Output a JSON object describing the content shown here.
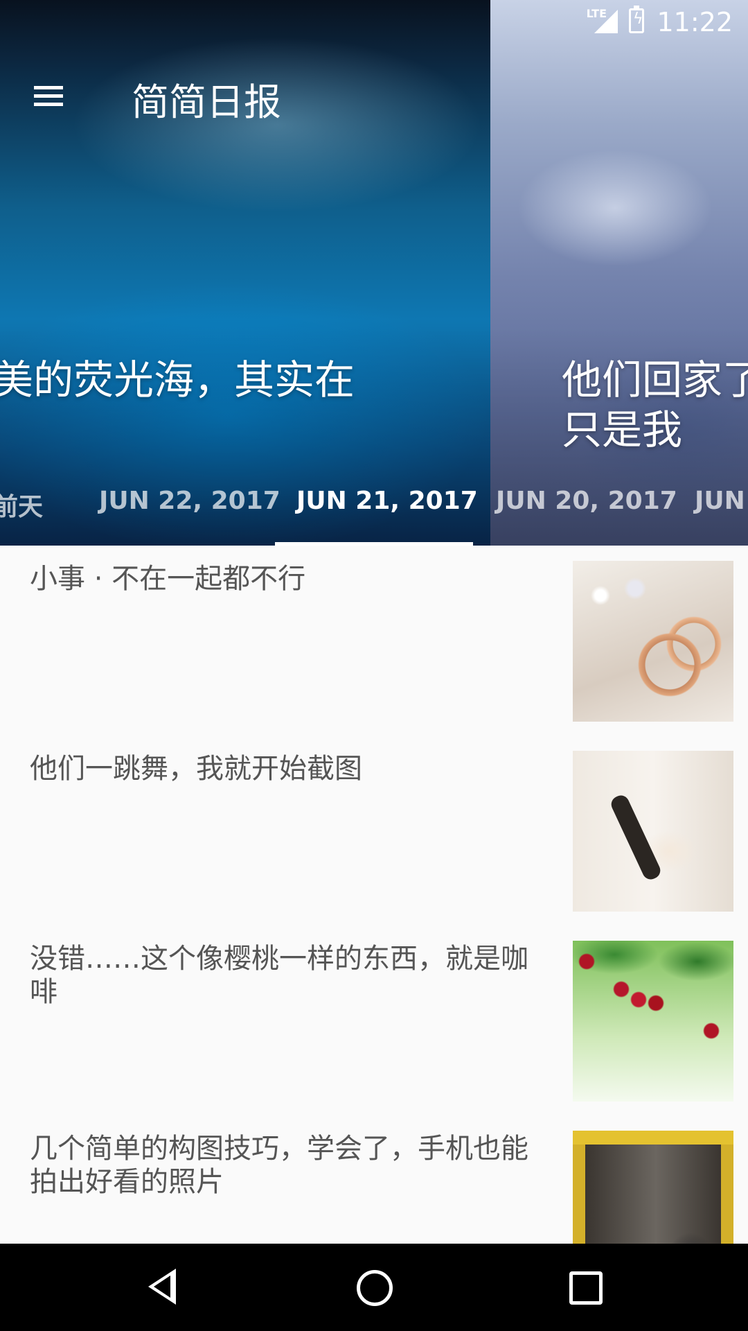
{
  "status": {
    "network": "LTE",
    "time": "11:22"
  },
  "toolbar": {
    "title": "简简日报"
  },
  "hero": {
    "slides": [
      {
        "title": "美的荧光海，其实在"
      },
      {
        "title": "他们回家了吗？只是我"
      }
    ],
    "tabs": [
      "前天",
      "JUN 22, 2017",
      "JUN 21, 2017",
      "JUN 20, 2017",
      "JUN"
    ],
    "active_tab": "JUN 21, 2017"
  },
  "list": {
    "items": [
      {
        "title": "小事 · 不在一起都不行"
      },
      {
        "title": "他们一跳舞，我就开始截图"
      },
      {
        "title": "没错……这个像樱桃一样的东西，就是咖啡"
      },
      {
        "title": "几个简单的构图技巧，学会了，手机也能拍出好看的照片"
      }
    ]
  }
}
